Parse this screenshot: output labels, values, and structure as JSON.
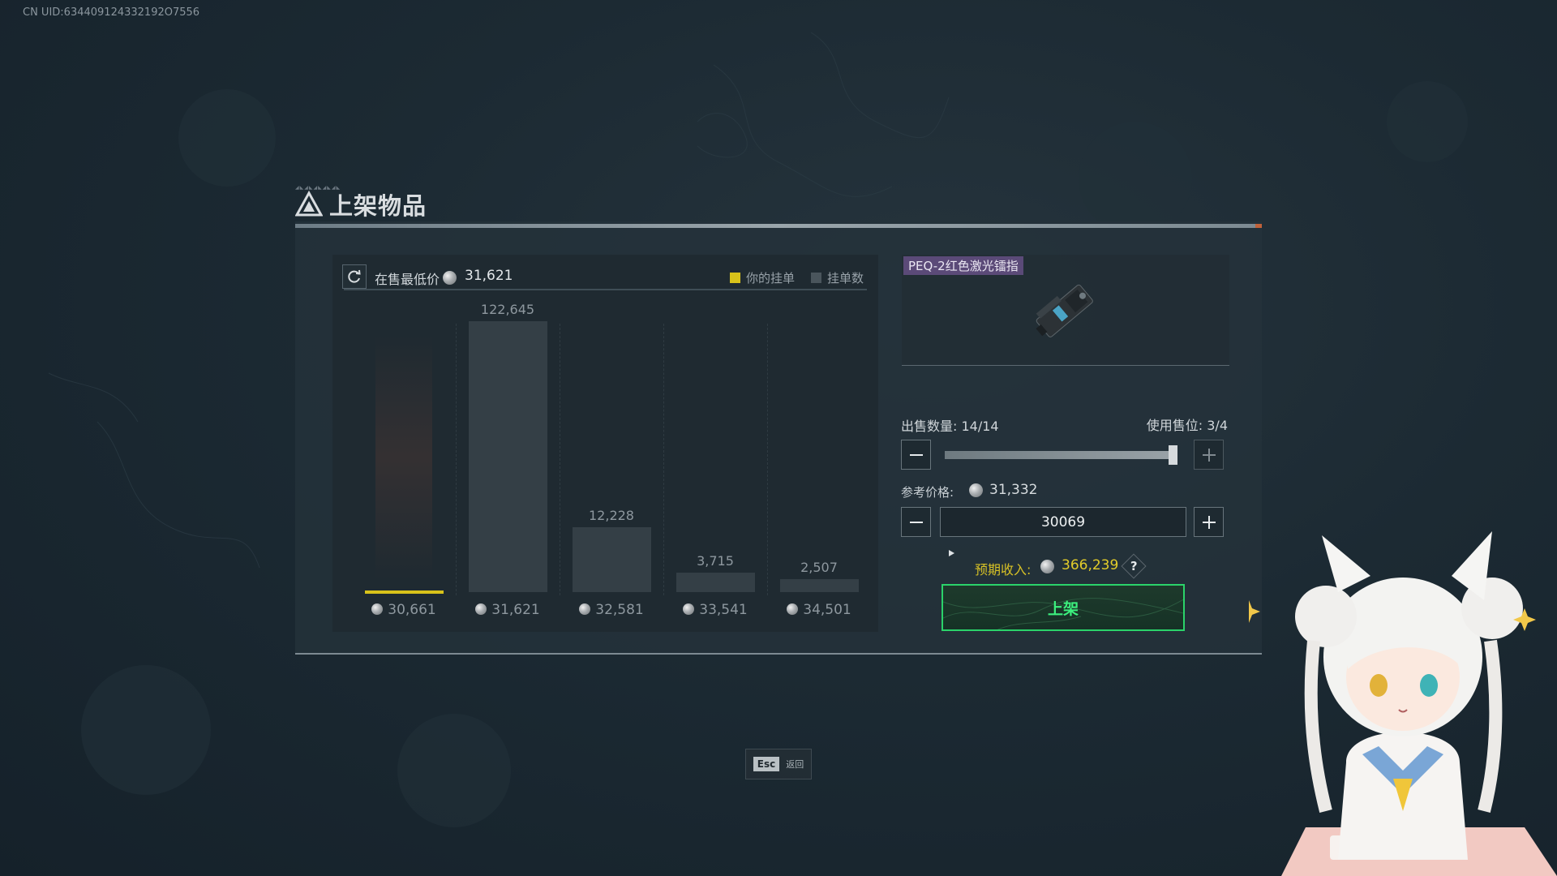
{
  "uid": "CN UID:634409124332192O7556",
  "window": {
    "title": "上架物品"
  },
  "market": {
    "lowest_label": "在售最低价",
    "lowest_value": "31,621",
    "legend_mine": "你的挂单",
    "legend_count": "挂单数",
    "colors": {
      "mine": "#d8c21a",
      "count": "#4a555c"
    }
  },
  "chart_data": {
    "type": "bar",
    "categories": [
      "30,661",
      "31,621",
      "32,581",
      "33,541",
      "34,501"
    ],
    "series": [
      {
        "name": "挂单数",
        "values": [
          0,
          122645,
          12228,
          3715,
          2507
        ]
      },
      {
        "name": "你的挂单",
        "values": [
          14,
          0,
          0,
          0,
          0
        ]
      }
    ],
    "value_labels": [
      "",
      "122,645",
      "12,228",
      "3,715",
      "2,507"
    ],
    "title": "",
    "xlabel": "",
    "ylabel": ""
  },
  "item": {
    "name": "PEQ-2红色激光镭指"
  },
  "sell": {
    "qty_label": "出售数量: 14/14",
    "slots_label": "使用售位: 3/4",
    "quantity": 14,
    "quantity_max": 14,
    "ref_label": "参考价格:",
    "ref_value": "31,332",
    "price_input": "30069",
    "income_label": "预期收入:",
    "income_value": "366,239",
    "help": "?",
    "submit_label": "上架"
  },
  "footer": {
    "esc_key": "Esc",
    "esc_text": "返回"
  },
  "icons": [
    "refresh-icon",
    "coin-icon",
    "minus-icon",
    "plus-icon",
    "help-icon",
    "title-logo-icon"
  ]
}
